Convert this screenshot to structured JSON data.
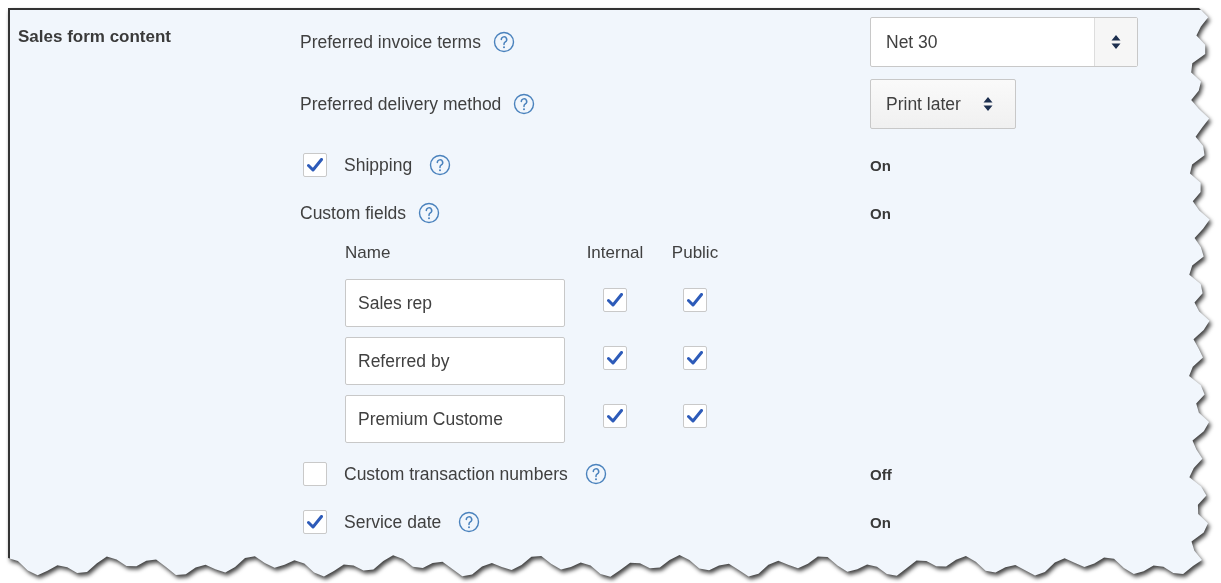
{
  "section": {
    "title": "Sales form content"
  },
  "settings": [
    {
      "kind": "select",
      "label": "Preferred invoice terms",
      "value": "Net 30"
    },
    {
      "kind": "dropdown",
      "label": "Preferred delivery method",
      "value": "Print later"
    },
    {
      "kind": "checkbox",
      "label": "Shipping",
      "checked": true,
      "status": "On"
    },
    {
      "kind": "text",
      "label": "Custom fields",
      "status": "On"
    },
    {
      "kind": "table",
      "columns": [
        "Name",
        "Internal",
        "Public"
      ],
      "rows": [
        {
          "name": "Sales rep",
          "internal": true,
          "public": true
        },
        {
          "name": "Referred by",
          "internal": true,
          "public": true
        },
        {
          "name": "Premium Custome",
          "internal": true,
          "public": true
        }
      ]
    },
    {
      "kind": "checkbox",
      "label": "Custom transaction numbers",
      "checked": false,
      "status": "Off"
    },
    {
      "kind": "checkbox",
      "label": "Service date",
      "checked": true,
      "status": "On"
    }
  ]
}
